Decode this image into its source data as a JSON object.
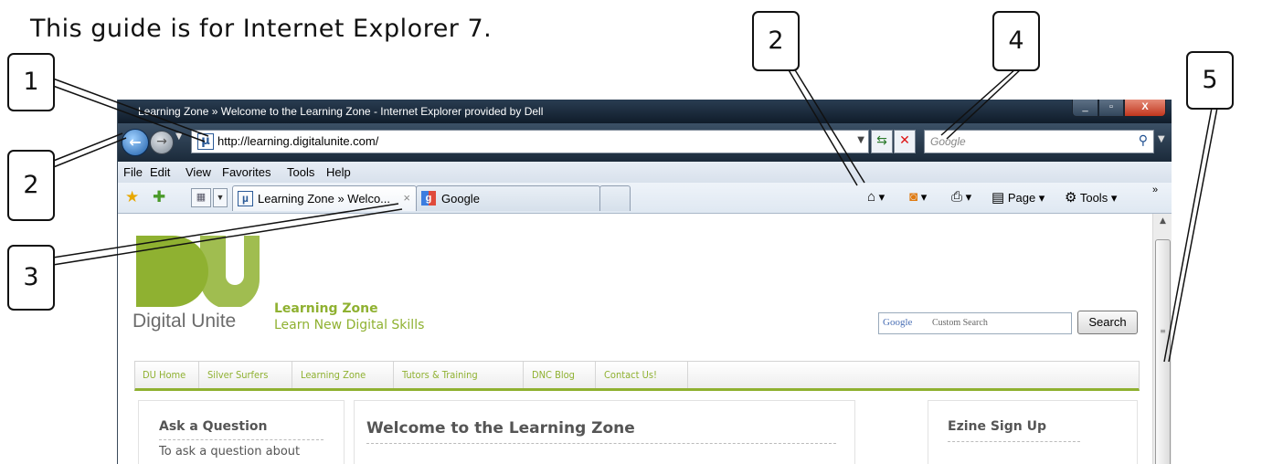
{
  "caption": "This guide is for Internet Explorer 7.",
  "callouts": [
    "1",
    "2",
    "2",
    "3",
    "4",
    "5"
  ],
  "window": {
    "title": "Learning Zone » Welcome to the Learning Zone - Internet Explorer provided by Dell",
    "minimize": "_",
    "maximize": "▫",
    "close": "X"
  },
  "address": {
    "url": "http://learning.digitalunite.com/",
    "favicon": "µ",
    "search_placeholder": "Google"
  },
  "menu": [
    "File",
    "Edit",
    "View",
    "Favorites",
    "Tools",
    "Help"
  ],
  "tabs": [
    {
      "label": "Learning Zone » Welco...",
      "favicon": "µ",
      "close": "×"
    },
    {
      "label": "Google",
      "favicon": "g"
    }
  ],
  "command_bar": {
    "page": "Page",
    "tools": "Tools"
  },
  "page": {
    "logo_text": "Digital Unite",
    "brand_title": "Learning Zone",
    "brand_subtitle": "Learn New Digital Skills",
    "search_logo": "Google",
    "search_hint": "Custom Search",
    "search_button": "Search",
    "nav": [
      "DU Home",
      "Silver Surfers",
      "Learning Zone",
      "Tutors & Training",
      "DNC Blog",
      "Contact Us!"
    ],
    "ask_title": "Ask a Question",
    "ask_text": "To ask a question about",
    "welcome_title": "Welcome to the Learning Zone",
    "ezine_title": "Ezine Sign Up"
  },
  "colors": {
    "brand_green": "#8fb131",
    "title_bar": "#1b2a3a"
  }
}
